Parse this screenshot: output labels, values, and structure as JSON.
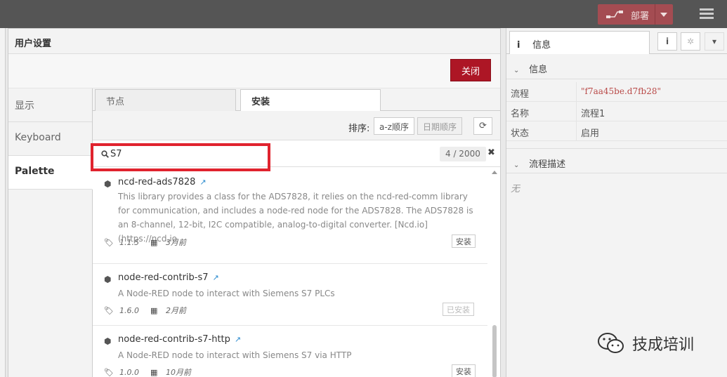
{
  "header": {
    "deploy_label": "部署"
  },
  "dialog": {
    "title": "用户设置",
    "close_label": "关闭",
    "side_tabs": [
      "显示",
      "Keyboard",
      "Palette"
    ],
    "panel_tabs": [
      "节点",
      "安装"
    ],
    "sort_label": "排序:",
    "sort_az": "a-z顺序",
    "sort_date": "日期顺序",
    "search_value": "S7",
    "count": "4 / 2000",
    "items": [
      {
        "name": "ncd-red-ads7828",
        "desc": "This library provides a class for the ADS7828, it relies on the ncd-red-comm library for communication, and includes a node-red node for the ADS7828. The ADS7828 is an 8-channel, 12-bit, I2C compatible, analog-to-digital converter. [Ncd.io](https://ncd.io",
        "version": "1.1.5",
        "date": "3月前",
        "action": "安装"
      },
      {
        "name": "node-red-contrib-s7",
        "desc": "A Node-RED node to interact with Siemens S7 PLCs",
        "version": "1.6.0",
        "date": "2月前",
        "action": "已安装"
      },
      {
        "name": "node-red-contrib-s7-http",
        "desc": "A Node-RED node to interact with Siemens S7 via HTTP",
        "version": "1.0.0",
        "date": "10月前",
        "action": "安装"
      }
    ]
  },
  "sidebar": {
    "tab_label": "信息",
    "section_info": "信息",
    "rows": [
      {
        "key": "流程",
        "value": "\"f7aa45be.d7fb28\""
      },
      {
        "key": "名称",
        "value": "流程1"
      },
      {
        "key": "状态",
        "value": "启用"
      }
    ],
    "section_desc": "流程描述",
    "desc_empty": "无"
  },
  "watermark": {
    "text": "技成培训"
  },
  "colors": {
    "accent": "#ad1625",
    "deploy": "#a44c52",
    "highlight": "#e0232e",
    "header": "#555555"
  }
}
